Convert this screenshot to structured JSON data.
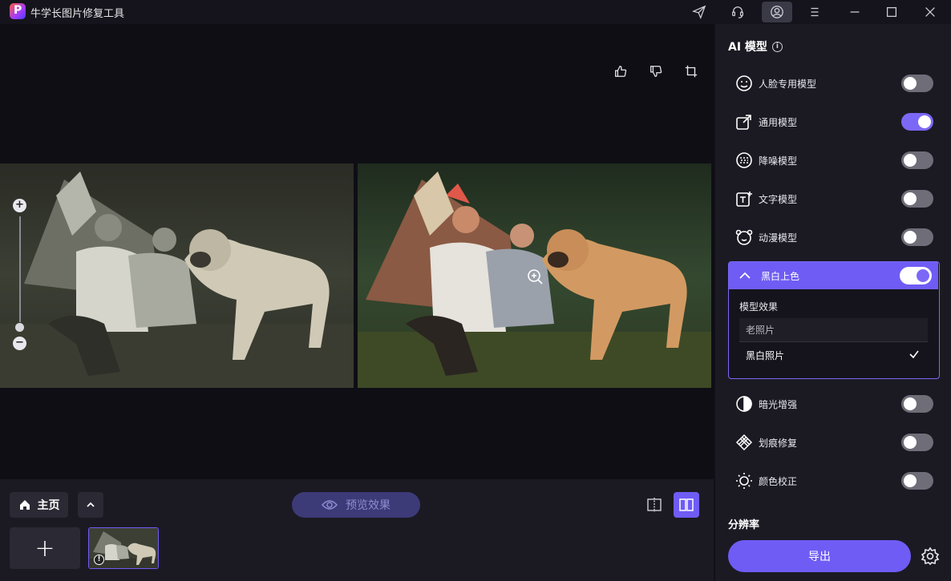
{
  "app": {
    "title": "牛学长图片修复工具",
    "logo_letter": "P"
  },
  "titlebar": {
    "icons": [
      "send-icon",
      "headset-icon",
      "user-icon",
      "menu-icon",
      "minimize-icon",
      "maximize-icon",
      "close-icon"
    ]
  },
  "canvas": {
    "top_tools": [
      "thumbs-up-icon",
      "thumbs-down-icon",
      "crop-icon"
    ],
    "zoom": {
      "plus": "+",
      "minus": "−"
    }
  },
  "bottom": {
    "home_label": "主页",
    "preview_label": "预览效果",
    "add_label": "+",
    "thumb_info": "!"
  },
  "panel": {
    "title": "AI 模型",
    "models": [
      {
        "label": "人脸专用模型",
        "icon": "face-icon",
        "on": false
      },
      {
        "label": "通用模型",
        "icon": "expand-icon",
        "on": true
      },
      {
        "label": "降噪模型",
        "icon": "noise-icon",
        "on": false
      },
      {
        "label": "文字模型",
        "icon": "text-icon",
        "on": false
      },
      {
        "label": "动漫模型",
        "icon": "anime-icon",
        "on": false
      }
    ],
    "colorize": {
      "label": "黑白上色",
      "on": true,
      "effect_label": "模型效果",
      "options": [
        "老照片",
        "黑白照片"
      ],
      "selected": "黑白照片"
    },
    "models_after": [
      {
        "label": "暗光增强",
        "icon": "contrast-icon",
        "on": false
      },
      {
        "label": "划痕修复",
        "icon": "scratch-icon",
        "on": false
      },
      {
        "label": "颜色校正",
        "icon": "sun-icon",
        "on": false
      }
    ],
    "resolution_label": "分辨率",
    "export_label": "导出"
  },
  "colors": {
    "accent": "#6f5cf5",
    "panel_bg": "#1b1a23",
    "canvas_bg": "#0f0e15"
  }
}
